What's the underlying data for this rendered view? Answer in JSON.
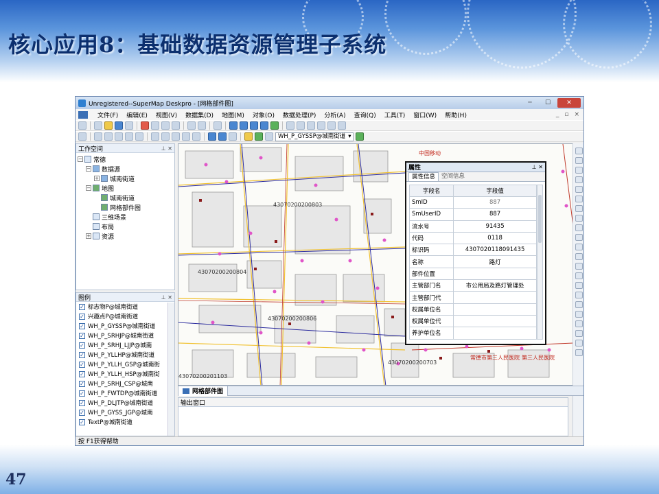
{
  "slide": {
    "title": "核心应用8：基础数据资源管理子系统",
    "page_number": "47"
  },
  "window": {
    "title": "Unregistered--SuperMap Deskpro - [网格部件图]",
    "menu": [
      "文件(F)",
      "编辑(E)",
      "视图(V)",
      "数据集(D)",
      "地图(M)",
      "对象(O)",
      "数据处理(P)",
      "分析(A)",
      "查询(Q)",
      "工具(T)",
      "窗口(W)",
      "帮助(H)"
    ],
    "layer_combo": "WH_P_GYSSP@城南街道",
    "status_text": "按 F1获得帮助"
  },
  "workspace": {
    "title": "工作空间",
    "items": [
      {
        "label": "常德",
        "level": 0
      },
      {
        "label": "数据源",
        "level": 1
      },
      {
        "label": "城南街道",
        "level": 2
      },
      {
        "label": "地图",
        "level": 1
      },
      {
        "label": "城南街道",
        "level": 2
      },
      {
        "label": "网格部件图",
        "level": 2
      },
      {
        "label": "三维场景",
        "level": 1
      },
      {
        "label": "布局",
        "level": 1
      },
      {
        "label": "资源",
        "level": 1
      }
    ]
  },
  "legend": {
    "title": "图例",
    "items": [
      "标志物P@城南街道",
      "兴趣点P@城南街道",
      "WH_P_GYSSP@城南街道",
      "WH_P_SRHJP@城南街道",
      "WH_P_SRHJ_LJJP@城南",
      "WH_P_YLLHP@城南街道",
      "WH_P_YLLH_GSP@城南街",
      "WH_P_YLLH_HSP@城南街",
      "WH_P_SRHJ_CSP@城南",
      "WH_P_FWTDP@城南街道",
      "WH_P_DLJTP@城南街道",
      "WH_P_GYSS_JGP@城南",
      "TextP@城南街道"
    ]
  },
  "map": {
    "tab_label": "网格部件图",
    "grid_labels": [
      "43070200200803",
      "43070200200804",
      "43070200200806",
      "43070200200703",
      "43070200201103"
    ],
    "poi_labels": [
      "中国移动",
      "常德市第三人民医院",
      "第三人民医院"
    ]
  },
  "output": {
    "title": "输出窗口"
  },
  "attributes": {
    "title": "属性",
    "tabs": [
      "属性信息",
      "空间信息"
    ],
    "headers": [
      "字段名",
      "字段值"
    ],
    "rows": [
      {
        "field": "SmID",
        "value": "887"
      },
      {
        "field": "SmUserID",
        "value": "887"
      },
      {
        "field": "流水号",
        "value": "91435"
      },
      {
        "field": "代码",
        "value": "0118"
      },
      {
        "field": "标识码",
        "value": "4307020118091435"
      },
      {
        "field": "名称",
        "value": "路灯"
      },
      {
        "field": "部件位置",
        "value": ""
      },
      {
        "field": "主管部门名",
        "value": "市公用局及路灯管理处"
      },
      {
        "field": "主管部门代",
        "value": ""
      },
      {
        "field": "权属单位名",
        "value": ""
      },
      {
        "field": "权属单位代",
        "value": ""
      },
      {
        "field": "养护单位名",
        "value": ""
      }
    ]
  }
}
